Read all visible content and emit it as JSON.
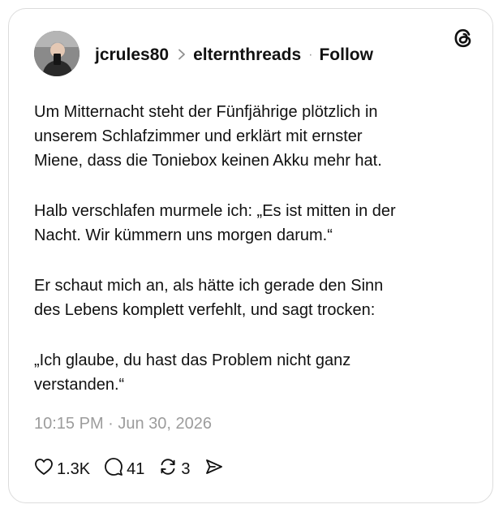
{
  "post": {
    "username": "jcrules80",
    "community": "elternthreads",
    "separator": "·",
    "follow_label": "Follow",
    "paragraphs": [
      [
        "Um Mitternacht steht der Fünfjährige plötzlich in",
        "unserem Schlafzimmer und erklärt mit ernster",
        "Miene, dass die Toniebox keinen Akku mehr hat."
      ],
      [
        "Halb verschlafen murmele ich: „Es ist mitten in der",
        "Nacht. Wir kümmern uns morgen darum.“"
      ],
      [
        "Er schaut mich an, als hätte ich gerade den Sinn",
        "des Lebens komplett verfehlt, und sagt trocken:"
      ],
      [
        "„Ich glaube, du hast das Problem nicht ganz",
        "verstanden.“"
      ]
    ],
    "timestamp": "10:15 PM · Jun 30, 2026"
  },
  "actions": {
    "likes": "1.3K",
    "replies": "41",
    "reposts": "3"
  },
  "icons": {
    "logo": "threads-logo-icon",
    "like": "heart-icon",
    "reply": "comment-icon",
    "repost": "repost-icon",
    "share": "share-icon"
  }
}
